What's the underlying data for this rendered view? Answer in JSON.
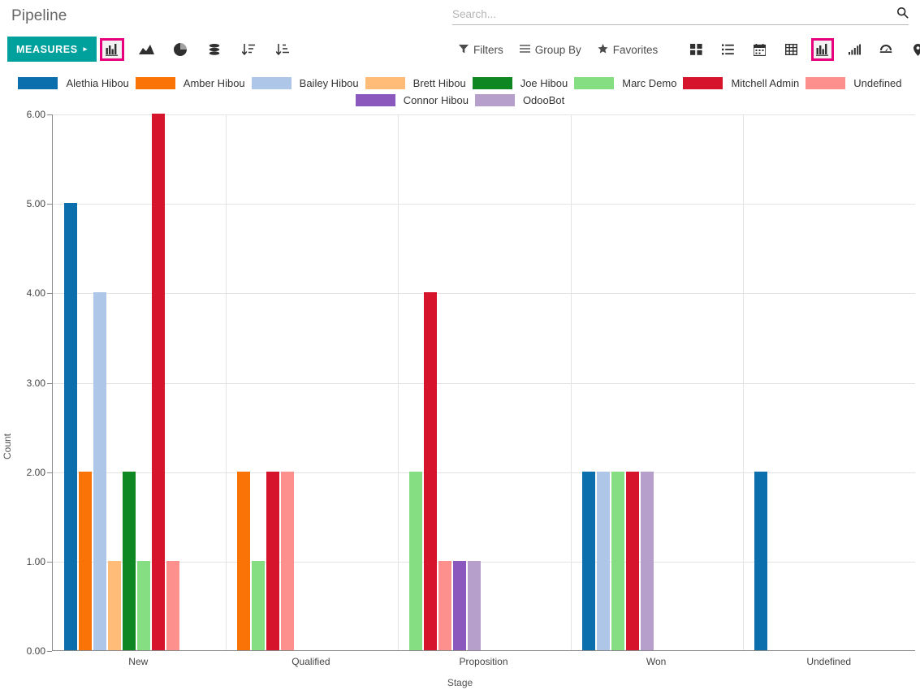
{
  "header": {
    "title": "Pipeline"
  },
  "search": {
    "placeholder": "Search...",
    "value": "",
    "icon": "search-icon"
  },
  "toolbar": {
    "measures_label": "MEASURES",
    "measures_caret": "▸",
    "graph_type_icons": [
      {
        "name": "bar-chart-icon",
        "active": true
      },
      {
        "name": "line-chart-icon",
        "active": false
      },
      {
        "name": "pie-chart-icon",
        "active": false
      },
      {
        "name": "stacked-icon",
        "active": false
      },
      {
        "name": "sort-descending-icon",
        "active": false
      },
      {
        "name": "sort-ascending-icon",
        "active": false
      }
    ],
    "filters": [
      {
        "name": "filters-button",
        "label": "Filters",
        "icon": "funnel-icon"
      },
      {
        "name": "group-by-button",
        "label": "Group By",
        "icon": "bars-icon"
      },
      {
        "name": "favorites-button",
        "label": "Favorites",
        "icon": "star-icon"
      }
    ],
    "view_icons": [
      {
        "name": "kanban-view-icon",
        "active": false
      },
      {
        "name": "list-view-icon",
        "active": false
      },
      {
        "name": "calendar-view-icon",
        "active": false
      },
      {
        "name": "pivot-view-icon",
        "active": false
      },
      {
        "name": "graph-view-icon",
        "active": true
      },
      {
        "name": "cohort-view-icon",
        "active": false
      },
      {
        "name": "dashboard-view-icon",
        "active": false
      },
      {
        "name": "map-view-icon",
        "active": false
      },
      {
        "name": "activity-view-icon",
        "active": false
      }
    ],
    "accent_color": "#00A09D",
    "highlight_color": "#e6007e"
  },
  "chart_data": {
    "type": "bar",
    "title": "",
    "xlabel": "Stage",
    "ylabel": "Count",
    "categories": [
      "New",
      "Qualified",
      "Proposition",
      "Won",
      "Undefined"
    ],
    "ylim": [
      0,
      6
    ],
    "yticks": [
      "0.00",
      "1.00",
      "2.00",
      "3.00",
      "4.00",
      "5.00",
      "6.00"
    ],
    "grid": true,
    "legend_position": "top",
    "series": [
      {
        "name": "Alethia Hibou",
        "color": "#0b6fae",
        "values": [
          5,
          0,
          0,
          2,
          2
        ]
      },
      {
        "name": "Amber Hibou",
        "color": "#f97306",
        "values": [
          2,
          2,
          0,
          0,
          0
        ]
      },
      {
        "name": "Bailey Hibou",
        "color": "#aec7e8",
        "values": [
          4,
          0,
          0,
          2,
          0
        ]
      },
      {
        "name": "Brett Hibou",
        "color": "#ffbb78",
        "values": [
          1,
          0,
          0,
          0,
          0
        ]
      },
      {
        "name": "Joe Hibou",
        "color": "#0f8722",
        "values": [
          2,
          0,
          0,
          0,
          0
        ]
      },
      {
        "name": "Marc Demo",
        "color": "#85df82",
        "values": [
          1,
          1,
          2,
          2,
          0
        ]
      },
      {
        "name": "Mitchell Admin",
        "color": "#d6142c",
        "values": [
          6,
          2,
          4,
          2,
          0
        ]
      },
      {
        "name": "Undefined",
        "color": "#fd8f8d",
        "values": [
          1,
          2,
          1,
          0,
          0
        ]
      },
      {
        "name": "Connor Hibou",
        "color": "#8b58bd",
        "values": [
          0,
          0,
          1,
          0,
          0
        ]
      },
      {
        "name": "OdooBot",
        "color": "#b79fcc",
        "values": [
          0,
          0,
          1,
          2,
          0
        ]
      }
    ]
  }
}
